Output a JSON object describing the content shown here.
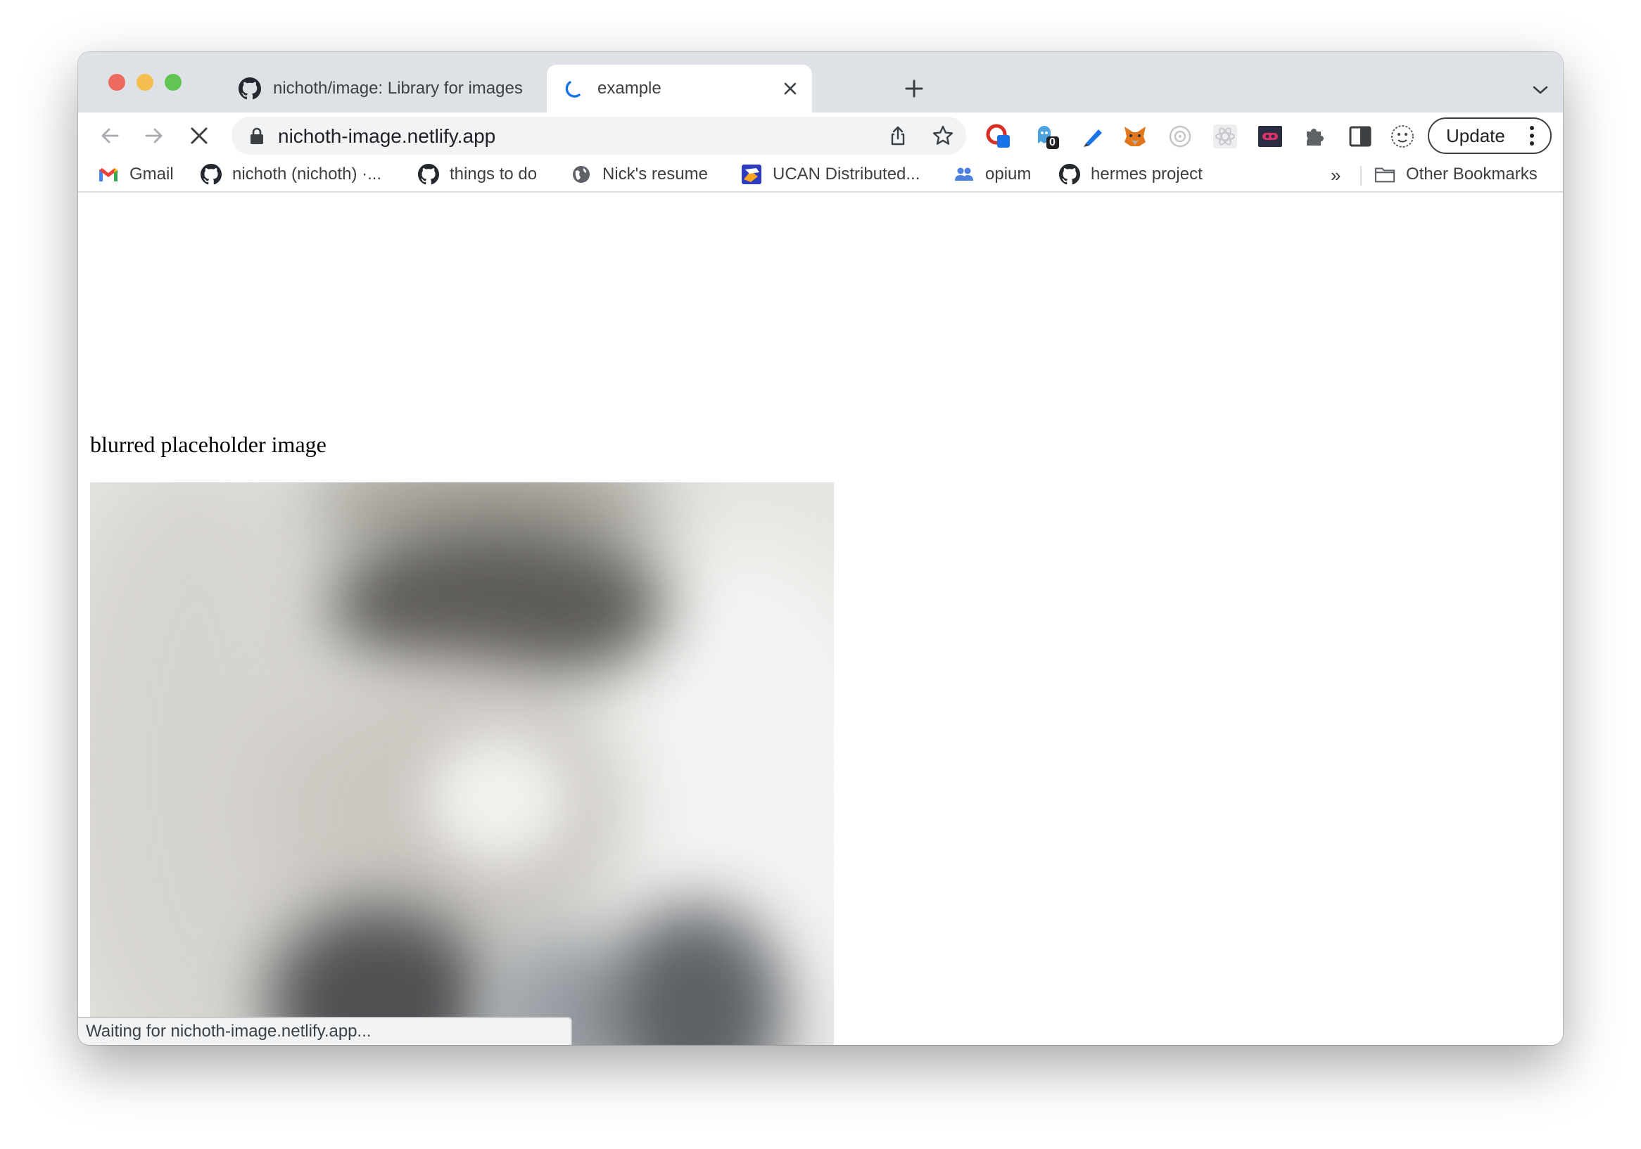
{
  "browser": {
    "tabs": [
      {
        "title": "nichoth/image: Library for images",
        "favicon": "github-icon",
        "active": false
      },
      {
        "title": "example",
        "favicon": "loading-spinner-icon",
        "active": true
      }
    ],
    "address_bar": {
      "url": "nichoth-image.netlify.app"
    },
    "update_button": "Update",
    "bookmarks": [
      {
        "label": "Gmail",
        "icon": "gmail-icon"
      },
      {
        "label": "nichoth (nichoth) ·...",
        "icon": "github-icon"
      },
      {
        "label": "things to do",
        "icon": "github-icon"
      },
      {
        "label": "Nick's resume",
        "icon": "globe-icon"
      },
      {
        "label": "UCAN Distributed...",
        "icon": "ucan-icon"
      },
      {
        "label": "opium",
        "icon": "people-icon"
      },
      {
        "label": "hermes project",
        "icon": "github-icon"
      }
    ],
    "bookmarks_overflow": "»",
    "other_bookmarks": "Other Bookmarks",
    "status_text": "Waiting for nichoth-image.netlify.app...",
    "extension_badge": "0"
  },
  "page": {
    "caption": "blurred placeholder image"
  }
}
